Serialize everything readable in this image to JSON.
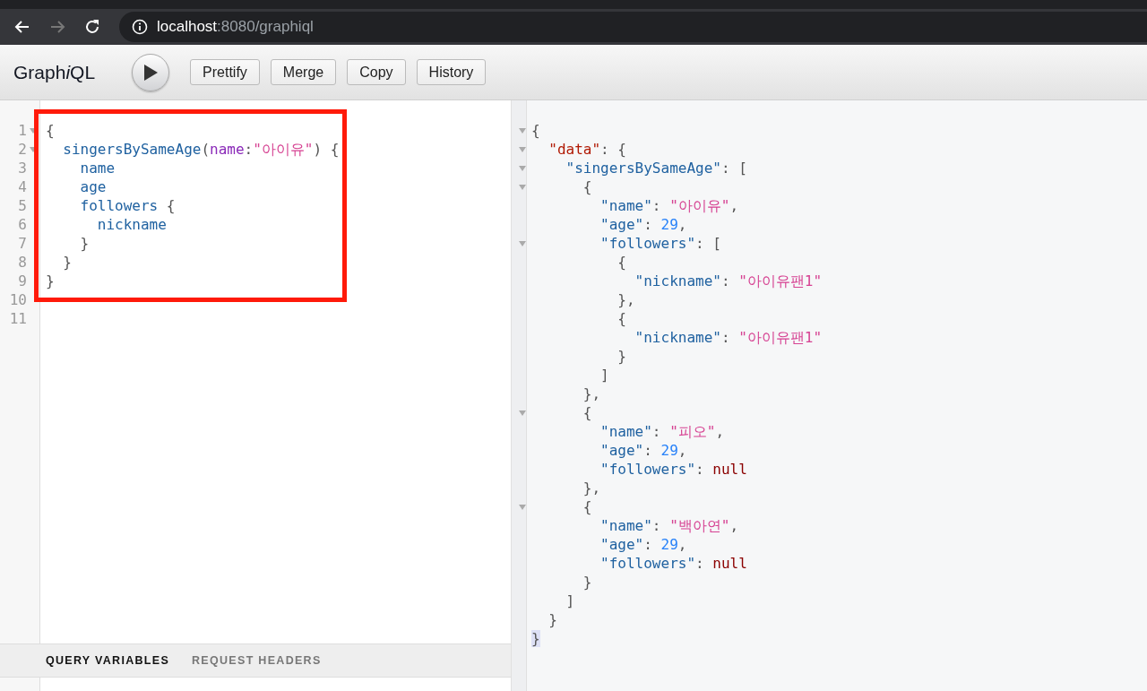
{
  "browser": {
    "back": {
      "disabled": false
    },
    "forward": {
      "disabled": true
    },
    "url_host": "localhost",
    "url_path": ":8080/graphiql"
  },
  "toolbar": {
    "logo": [
      {
        "text": "Graph",
        "italic": false
      },
      {
        "text": "i",
        "italic": true
      },
      {
        "text": "QL",
        "italic": false
      }
    ],
    "buttons": [
      "Prettify",
      "Merge",
      "Copy",
      "History"
    ]
  },
  "query_editor": {
    "blocks": [
      {
        "highlighted": true,
        "lines": [
          {
            "number": "1",
            "fold": true,
            "tokens": [
              {
                "kind": "punct",
                "text": "{"
              }
            ]
          },
          {
            "number": "2",
            "fold": true,
            "tokens": [
              {
                "kind": "field",
                "text": "  singersBySameAge"
              },
              {
                "kind": "punct",
                "text": "("
              },
              {
                "kind": "attr",
                "text": "name"
              },
              {
                "kind": "punct",
                "text": ":"
              },
              {
                "kind": "string",
                "text": "\"아이유\""
              },
              {
                "kind": "punct",
                "text": ") {"
              }
            ]
          },
          {
            "number": "3",
            "fold": false,
            "tokens": [
              {
                "kind": "field",
                "text": "    name"
              }
            ]
          },
          {
            "number": "4",
            "fold": false,
            "tokens": [
              {
                "kind": "field",
                "text": "    age"
              }
            ]
          },
          {
            "number": "5",
            "fold": false,
            "tokens": [
              {
                "kind": "field",
                "text": "    followers"
              },
              {
                "kind": "punct",
                "text": " {"
              }
            ]
          },
          {
            "number": "6",
            "fold": false,
            "tokens": [
              {
                "kind": "field",
                "text": "      nickname"
              }
            ]
          },
          {
            "number": "7",
            "fold": false,
            "tokens": [
              {
                "kind": "punct",
                "text": "    }"
              }
            ]
          },
          {
            "number": "8",
            "fold": false,
            "tokens": [
              {
                "kind": "punct",
                "text": "  }"
              }
            ]
          },
          {
            "number": "9",
            "fold": false,
            "tokens": [
              {
                "kind": "punct",
                "text": "}"
              }
            ]
          }
        ]
      },
      {
        "highlighted": false,
        "lines": [
          {
            "number": "10",
            "fold": false
          },
          {
            "number": "11",
            "fold": false
          }
        ]
      }
    ]
  },
  "bottom_tabs": [
    {
      "label": "QUERY VARIABLES",
      "selected": true
    },
    {
      "label": "REQUEST HEADERS",
      "selected": false
    }
  ],
  "result": {
    "lines": [
      {
        "fold": true,
        "tokens": [
          {
            "kind": "punct",
            "text": "{"
          }
        ]
      },
      {
        "fold": true,
        "tokens": [
          {
            "kind": "def",
            "text": "  \"data\""
          },
          {
            "kind": "punct",
            "text": ": {"
          }
        ]
      },
      {
        "fold": true,
        "tokens": [
          {
            "kind": "key",
            "text": "    \"singersBySameAge\""
          },
          {
            "kind": "punct",
            "text": ": ["
          }
        ]
      },
      {
        "fold": true,
        "tokens": [
          {
            "kind": "punct",
            "text": "      {"
          }
        ]
      },
      {
        "fold": false,
        "tokens": [
          {
            "kind": "key",
            "text": "        \"name\""
          },
          {
            "kind": "punct",
            "text": ": "
          },
          {
            "kind": "string",
            "text": "\"아이유\""
          },
          {
            "kind": "punct",
            "text": ","
          }
        ]
      },
      {
        "fold": false,
        "tokens": [
          {
            "kind": "key",
            "text": "        \"age\""
          },
          {
            "kind": "punct",
            "text": ": "
          },
          {
            "kind": "number",
            "text": "29"
          },
          {
            "kind": "punct",
            "text": ","
          }
        ]
      },
      {
        "fold": true,
        "tokens": [
          {
            "kind": "key",
            "text": "        \"followers\""
          },
          {
            "kind": "punct",
            "text": ": ["
          }
        ]
      },
      {
        "fold": false,
        "tokens": [
          {
            "kind": "punct",
            "text": "          {"
          }
        ]
      },
      {
        "fold": false,
        "tokens": [
          {
            "kind": "key",
            "text": "            \"nickname\""
          },
          {
            "kind": "punct",
            "text": ": "
          },
          {
            "kind": "string",
            "text": "\"아이유팬1\""
          }
        ]
      },
      {
        "fold": false,
        "tokens": [
          {
            "kind": "punct",
            "text": "          },"
          }
        ]
      },
      {
        "fold": false,
        "tokens": [
          {
            "kind": "punct",
            "text": "          {"
          }
        ]
      },
      {
        "fold": false,
        "tokens": [
          {
            "kind": "key",
            "text": "            \"nickname\""
          },
          {
            "kind": "punct",
            "text": ": "
          },
          {
            "kind": "string",
            "text": "\"아이유팬1\""
          }
        ]
      },
      {
        "fold": false,
        "tokens": [
          {
            "kind": "punct",
            "text": "          }"
          }
        ]
      },
      {
        "fold": false,
        "tokens": [
          {
            "kind": "punct",
            "text": "        ]"
          }
        ]
      },
      {
        "fold": false,
        "tokens": [
          {
            "kind": "punct",
            "text": "      },"
          }
        ]
      },
      {
        "fold": true,
        "tokens": [
          {
            "kind": "punct",
            "text": "      {"
          }
        ]
      },
      {
        "fold": false,
        "tokens": [
          {
            "kind": "key",
            "text": "        \"name\""
          },
          {
            "kind": "punct",
            "text": ": "
          },
          {
            "kind": "string",
            "text": "\"피오\""
          },
          {
            "kind": "punct",
            "text": ","
          }
        ]
      },
      {
        "fold": false,
        "tokens": [
          {
            "kind": "key",
            "text": "        \"age\""
          },
          {
            "kind": "punct",
            "text": ": "
          },
          {
            "kind": "number",
            "text": "29"
          },
          {
            "kind": "punct",
            "text": ","
          }
        ]
      },
      {
        "fold": false,
        "tokens": [
          {
            "kind": "key",
            "text": "        \"followers\""
          },
          {
            "kind": "punct",
            "text": ": "
          },
          {
            "kind": "null",
            "text": "null"
          }
        ]
      },
      {
        "fold": false,
        "tokens": [
          {
            "kind": "punct",
            "text": "      },"
          }
        ]
      },
      {
        "fold": true,
        "tokens": [
          {
            "kind": "punct",
            "text": "      {"
          }
        ]
      },
      {
        "fold": false,
        "tokens": [
          {
            "kind": "key",
            "text": "        \"name\""
          },
          {
            "kind": "punct",
            "text": ": "
          },
          {
            "kind": "string",
            "text": "\"백아연\""
          },
          {
            "kind": "punct",
            "text": ","
          }
        ]
      },
      {
        "fold": false,
        "tokens": [
          {
            "kind": "key",
            "text": "        \"age\""
          },
          {
            "kind": "punct",
            "text": ": "
          },
          {
            "kind": "number",
            "text": "29"
          },
          {
            "kind": "punct",
            "text": ","
          }
        ]
      },
      {
        "fold": false,
        "tokens": [
          {
            "kind": "key",
            "text": "        \"followers\""
          },
          {
            "kind": "punct",
            "text": ": "
          },
          {
            "kind": "null",
            "text": "null"
          }
        ]
      },
      {
        "fold": false,
        "tokens": [
          {
            "kind": "punct",
            "text": "      }"
          }
        ]
      },
      {
        "fold": false,
        "tokens": [
          {
            "kind": "punct",
            "text": "    ]"
          }
        ]
      },
      {
        "fold": false,
        "tokens": [
          {
            "kind": "punct",
            "text": "  }"
          }
        ]
      },
      {
        "fold": false,
        "tokens": [
          {
            "kind": "bracket_match",
            "text": "}"
          }
        ]
      }
    ]
  }
}
